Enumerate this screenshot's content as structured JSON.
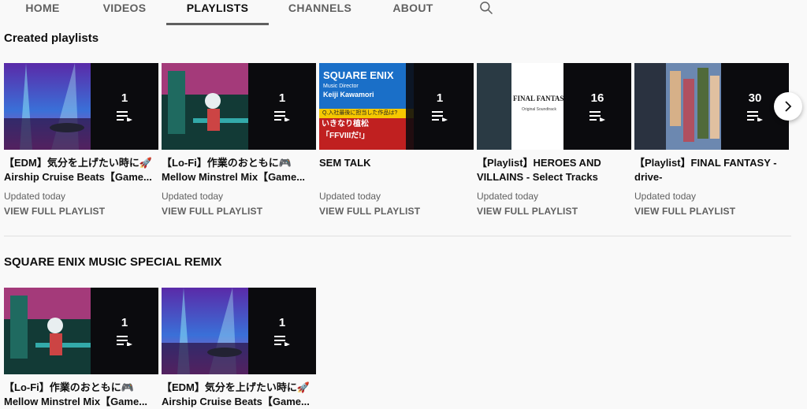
{
  "tabs": [
    {
      "label": "HOME"
    },
    {
      "label": "VIDEOS"
    },
    {
      "label": "PLAYLISTS"
    },
    {
      "label": "CHANNELS"
    },
    {
      "label": "ABOUT"
    }
  ],
  "search_icon": "search-icon",
  "sections": [
    {
      "title": "Created playlists",
      "cards": [
        {
          "count": "1",
          "title_line1": "【EDM】気分を上げたい時に🚀",
          "title_line2": "Airship Cruise Beats【Game...",
          "updated": "Updated today",
          "view": "VIEW FULL PLAYLIST",
          "art": "edm"
        },
        {
          "count": "1",
          "title_line1": "【Lo-Fi】作業のおともに🎮",
          "title_line2": "Mellow Minstrel Mix【Game...",
          "updated": "Updated today",
          "view": "VIEW FULL PLAYLIST",
          "art": "lofi"
        },
        {
          "count": "1",
          "title_line1": "SEM TALK",
          "title_line2": "",
          "updated": "Updated today",
          "view": "VIEW FULL PLAYLIST",
          "art": "semtalk"
        },
        {
          "count": "16",
          "title_line1": "【Playlist】HEROES AND",
          "title_line2": "VILLAINS - Select Tracks from...",
          "updated": "Updated today",
          "view": "VIEW FULL PLAYLIST",
          "art": "ff"
        },
        {
          "count": "30",
          "title_line1": "【Playlist】FINAL FANTASY -",
          "title_line2": "drive-",
          "updated": "Updated today",
          "view": "VIEW FULL PLAYLIST",
          "art": "ffdrive"
        }
      ]
    },
    {
      "title": "SQUARE ENIX MUSIC SPECIAL REMIX",
      "cards": [
        {
          "count": "1",
          "title_line1": "【Lo-Fi】作業のおともに🎮",
          "title_line2": "Mellow Minstrel Mix【Game...",
          "art": "lofi"
        },
        {
          "count": "1",
          "title_line1": "【EDM】気分を上げたい時に🚀",
          "title_line2": "Airship Cruise Beats【Game...",
          "art": "edm"
        }
      ]
    }
  ],
  "art_text": {
    "semtalk_brand": "SQUARE ENIX",
    "semtalk_role": "Music Director",
    "semtalk_name": "Keiji Kawamori",
    "semtalk_q": "Q.入社最後に担当した作品は?",
    "semtalk_a1": "いきなり植松",
    "semtalk_a2": "「FFVIIIだ!」",
    "ff_logo": "FINAL FANTASY",
    "ff_sub": "Original Soundtrack"
  },
  "next_icon": "chevron-right-icon",
  "queue_icon": "playlist-queue-icon",
  "colors": {
    "active_tab_underline": "#606060",
    "overlay": "#0a0a0e"
  }
}
